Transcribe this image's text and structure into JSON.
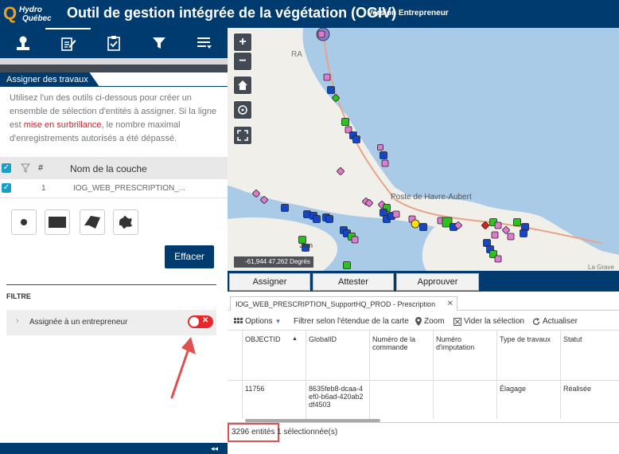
{
  "header": {
    "logo_q": "Q",
    "logo_line1": "Hydro",
    "logo_line2": "Québec",
    "title": "Outil de gestion intégrée de la végétation (OGIV)",
    "version": "Version Entrepreneur"
  },
  "toolbar": {
    "icons": [
      "person-icon",
      "edit-form-icon",
      "clipboard-check-icon",
      "filter-icon",
      "list-icon"
    ]
  },
  "panel": {
    "tab_label": "Assigner des travaux",
    "info_part1": "Utilisez l'un des outils ci-dessous pour créer un ensemble de sélection d'entités à assigner. Si la ligne est ",
    "info_highlight": "mise en surbrillance",
    "info_part2": ", le nombre maximal d'enregistrements autorisés a été dépassé.",
    "table_headers": {
      "num": "#",
      "layer": "Nom de la couche"
    },
    "rows": [
      {
        "num": "1",
        "layer": "IOG_WEB_PRESCRIPTION_..."
      }
    ],
    "clear_button": "Effacer",
    "filter_title": "FILTRE",
    "filter_item": "Assignée à un entrepreneur",
    "filter_enabled": false
  },
  "map": {
    "label_ra": "RA",
    "label_poste": "Poste de Havre-Aubert",
    "label_grave": "La Grave",
    "scale": "3km",
    "coords": "-61,944 47,262 Degrés",
    "accent_blue": "#1446c8",
    "accent_green": "#2ec21e",
    "accent_pink": "#e07ad0",
    "accent_red": "#e02020"
  },
  "actions": {
    "assign": "Assigner",
    "attest": "Attester",
    "approve": "Approuver"
  },
  "grid": {
    "tab_title": "IOG_WEB_PRESCRIPTION_SupportHQ_PROD - Prescription",
    "toolbar": {
      "options": "Options",
      "filter_extent": "Filtrer selon l'étendue de la carte",
      "zoom": "Zoom",
      "clear_selection": "Vider la sélection",
      "refresh": "Actualiser"
    },
    "columns": [
      "OBJECTID",
      "GlobalID",
      "Numéro de la commande",
      "Numéro d'imputation",
      "Type de travaux",
      "Statut"
    ],
    "rows": [
      {
        "objectid": "11756",
        "globalid": "8635feb8-dcaa-4ef0-b6ad-420ab2df4503",
        "commande": "",
        "imputation": "",
        "type": "Élagage",
        "statut": "Réalisée"
      }
    ]
  },
  "status": {
    "count": "3296 entités",
    "selected": "1 sélectionnée(s)"
  }
}
